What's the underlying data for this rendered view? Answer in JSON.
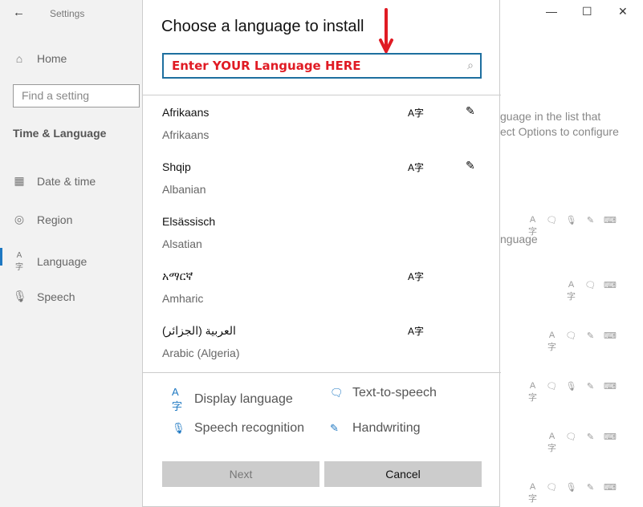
{
  "settings": {
    "title": "Settings",
    "home": "Home",
    "search_placeholder": "Find a setting",
    "section": "Time & Language",
    "nav": [
      {
        "label": "Date & time",
        "icon": "calendar-clock-icon"
      },
      {
        "label": "Region",
        "icon": "globe-icon"
      },
      {
        "label": "Language",
        "icon": "display-language-icon"
      },
      {
        "label": "Speech",
        "icon": "microphone-icon"
      }
    ],
    "bg_text": [
      "guage in the list that",
      "ect Options to configure",
      "nguage"
    ]
  },
  "dialog": {
    "title": "Choose a language to install",
    "search_placeholder": "Enter YOUR Language HERE",
    "languages": [
      {
        "native": "Afrikaans",
        "english": "Afrikaans",
        "display": true,
        "handwriting": true
      },
      {
        "native": "Shqip",
        "english": "Albanian",
        "display": true,
        "handwriting": true
      },
      {
        "native": "Elsässisch",
        "english": "Alsatian",
        "display": false,
        "handwriting": false
      },
      {
        "native": "አማርኛ",
        "english": "Amharic",
        "display": true,
        "handwriting": false
      },
      {
        "native": "العربية (الجزائر)",
        "english": "Arabic (Algeria)",
        "display": true,
        "handwriting": false
      }
    ],
    "legend": {
      "display": "Display language",
      "tts": "Text-to-speech",
      "speech": "Speech recognition",
      "handwriting": "Handwriting"
    },
    "next": "Next",
    "cancel": "Cancel"
  },
  "colors": {
    "accent": "#1e78c2",
    "annotation": "#e01b24",
    "input_border": "#1e6f9f"
  }
}
